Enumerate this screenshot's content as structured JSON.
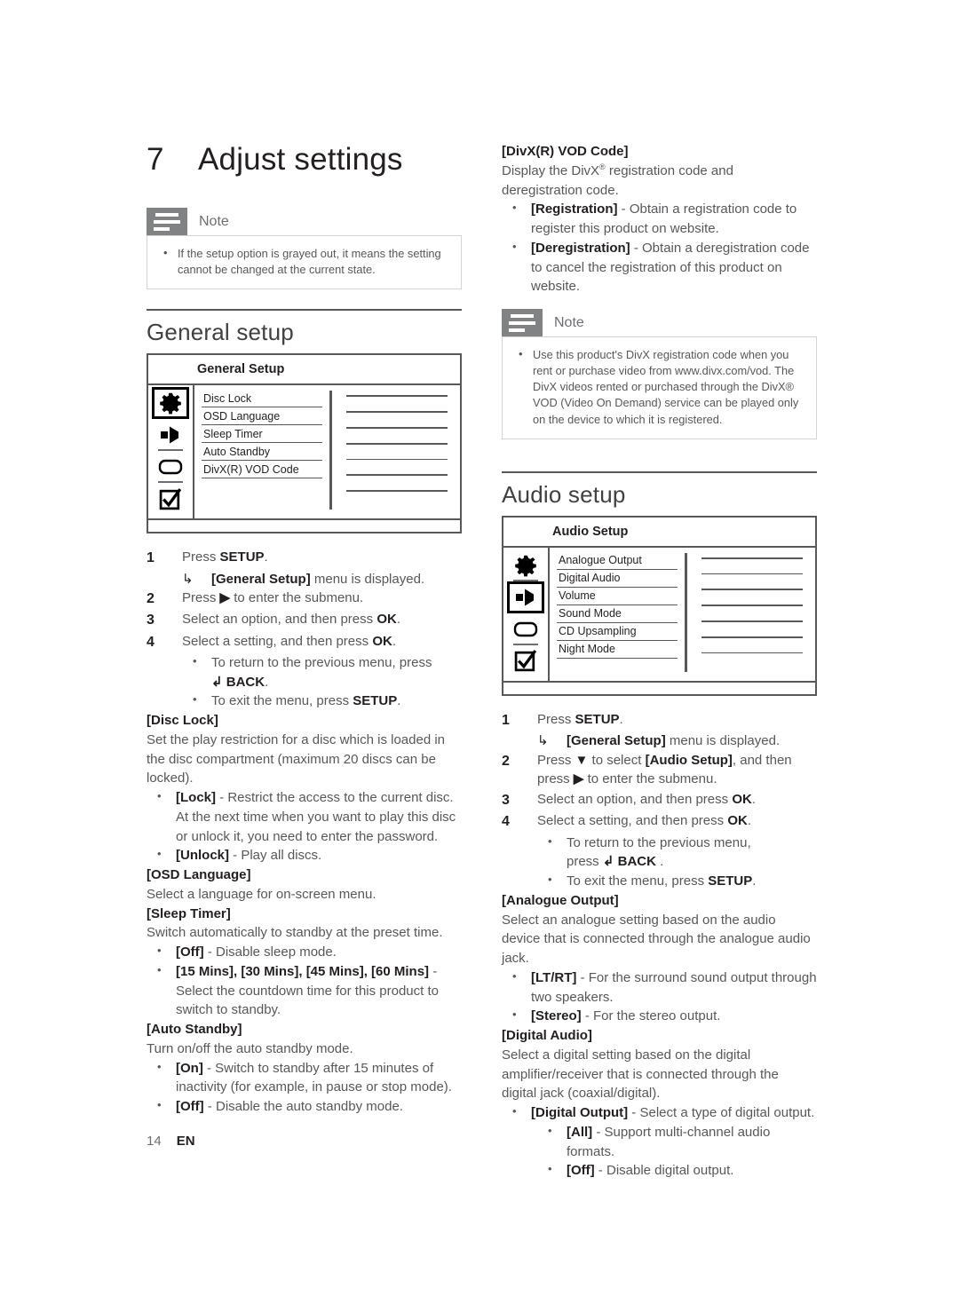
{
  "chapter": {
    "number": "7",
    "title": "Adjust settings"
  },
  "notes": {
    "general": {
      "label": "Note",
      "icon": "note-icon",
      "items": [
        "If the setup option is grayed out, it means the setting cannot be changed at the current state."
      ]
    },
    "divx": {
      "label": "Note",
      "icon": "note-icon",
      "items": [
        "Use this product's DivX registration code when you rent or purchase video from www.divx.com/vod. The DivX videos rented or purchased through the DivX® VOD (Video On Demand) service can be played only on the device to which it is registered."
      ]
    }
  },
  "general_setup": {
    "heading": "General setup",
    "osd": {
      "title": "General Setup",
      "rail_icons": [
        "gear-icon",
        "speaker-icon",
        "tv-icon",
        "checkbox-icon"
      ],
      "selected_icon_index": 0,
      "items": [
        "Disc Lock",
        "OSD Language",
        "Sleep Timer",
        "Auto Standby",
        "DivX(R) VOD Code"
      ],
      "value_line_count": 7
    },
    "steps": [
      {
        "num": "1",
        "text": "Press SETUP.",
        "bold": [
          "SETUP"
        ]
      },
      {
        "num": "2",
        "text": "Press ▶ to enter the submenu."
      },
      {
        "num": "3",
        "text": "Select an option, and then press OK.",
        "bold": [
          "OK"
        ]
      },
      {
        "num": "4",
        "text": "Select a setting, and then press OK.",
        "bold": [
          "OK"
        ]
      }
    ],
    "step1_result": "[General Setup] menu is displayed.",
    "step1_result_bold": "[General Setup]",
    "step4_bullets": [
      "To return to the previous menu, press ↰ BACK.",
      "To exit the menu, press SETUP."
    ]
  },
  "disc_lock": {
    "heading": "[Disc Lock]",
    "description": "Set the play restriction for a disc which is loaded in the disc compartment (maximum 20 discs can be locked).",
    "options": [
      {
        "label": "[Lock]",
        "text": " - Restrict the access to the current disc. At the next time when you want to play this disc or unlock it, you need to enter the password."
      },
      {
        "label": "[Unlock]",
        "text": " - Play all discs."
      }
    ]
  },
  "osd_language": {
    "heading": "[OSD Language]",
    "description": "Select a language for on-screen menu."
  },
  "sleep_timer": {
    "heading": "[Sleep Timer]",
    "description": "Switch automatically to standby at the preset time.",
    "options": [
      {
        "label": "[Off]",
        "text": " - Disable sleep mode."
      },
      {
        "label": "[15 Mins], [30 Mins], [45 Mins], [60 Mins]",
        "text": " - Select the countdown time for this product to switch to standby."
      }
    ]
  },
  "auto_standby": {
    "heading": "[Auto Standby]",
    "description": "Turn on/off the auto standby mode.",
    "options": [
      {
        "label": "[On]",
        "text": " - Switch to standby after 15 minutes of inactivity (for example, in pause or stop mode)."
      },
      {
        "label": "[Off]",
        "text": " - Disable the auto standby mode."
      }
    ]
  },
  "divx_vod": {
    "heading": "[DivX(R) VOD Code]",
    "description_pre": "Display the DivX",
    "description_sup": "®",
    "description_post": " registration code and deregistration code.",
    "options": [
      {
        "label": "[Registration]",
        "text": " - Obtain a registration code to register this product on website."
      },
      {
        "label": "[Deregistration]",
        "text": " - Obtain a deregistration code to cancel the registration of this product on website."
      }
    ]
  },
  "audio_setup": {
    "heading": "Audio setup",
    "osd": {
      "title": "Audio Setup",
      "rail_icons": [
        "gear-icon",
        "speaker-icon",
        "tv-icon",
        "checkbox-icon"
      ],
      "selected_icon_index": 1,
      "items": [
        "Analogue Output",
        "Digital Audio",
        "Volume",
        "Sound Mode",
        "CD Upsampling",
        "Night Mode"
      ],
      "value_line_count": 7
    },
    "steps": [
      {
        "num": "1",
        "text": "Press SETUP."
      },
      {
        "num": "2",
        "text": "Press ▼ to select [Audio Setup], and then press ▶ to enter the submenu."
      },
      {
        "num": "3",
        "text": "Select an option, and then press OK."
      },
      {
        "num": "4",
        "text": "Select a setting, and then press OK."
      }
    ],
    "step1_result": "[General Setup] menu is displayed.",
    "step1_result_bold": "[General Setup]",
    "step4_bullets": [
      "To return to the previous menu, press ↰ BACK .",
      "To exit the menu, press SETUP."
    ]
  },
  "analogue_output": {
    "heading": "[Analogue Output]",
    "description": "Select an analogue setting based on the audio device that is connected through the analogue audio jack.",
    "options": [
      {
        "label": "[LT/RT]",
        "text": " - For the surround sound output through two speakers."
      },
      {
        "label": "[Stereo]",
        "text": " - For the stereo output."
      }
    ]
  },
  "digital_audio": {
    "heading": "[Digital Audio]",
    "description": "Select a digital setting based on the digital amplifier/receiver that is connected through the digital jack (coaxial/digital).",
    "options": [
      {
        "label": "[Digital Output]",
        "text": " - Select a type of digital output."
      }
    ],
    "sub_options": [
      {
        "label": "[All]",
        "text": " - Support multi-channel audio formats."
      },
      {
        "label": "[Off]",
        "text": " - Disable digital output."
      }
    ]
  },
  "footer": {
    "page_number": "14",
    "language": "EN"
  },
  "labels": {
    "press": "Press ",
    "setup_key": "SETUP",
    "ok_key": "OK",
    "back_key": "BACK",
    "right_arrow": "▶",
    "down_arrow": "▼",
    "result_arrow": "↳"
  }
}
